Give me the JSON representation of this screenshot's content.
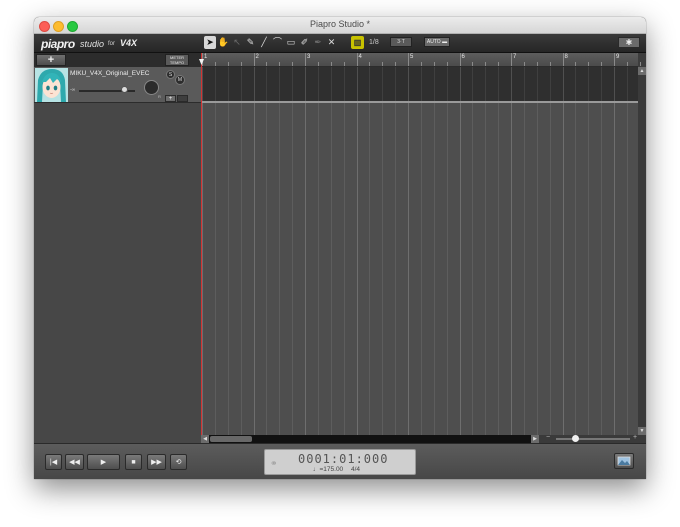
{
  "window": {
    "title": "Piapro Studio *"
  },
  "brand": {
    "logo": "piapro",
    "logo_studio": "studio",
    "logo_for": "for",
    "logo_v4x": "V4X"
  },
  "toolbar": {
    "tools": [
      {
        "name": "select-tool-icon",
        "glyph": "➤",
        "active": true
      },
      {
        "name": "hand-tool-icon",
        "glyph": "✋"
      },
      {
        "name": "arrow-tool-icon",
        "glyph": "↖",
        "dim": true
      },
      {
        "name": "pencil-tool-icon",
        "glyph": "✎"
      },
      {
        "name": "line-tool-icon",
        "glyph": "╱"
      },
      {
        "name": "curve-tool-icon",
        "glyph": "⌒"
      },
      {
        "name": "eraser-tool-icon",
        "glyph": "▭"
      },
      {
        "name": "brush-tool-icon",
        "glyph": "✐"
      },
      {
        "name": "pen-tool-icon",
        "glyph": "✒",
        "dim": true
      },
      {
        "name": "cut-tool-icon",
        "glyph": "✕"
      }
    ],
    "snap_label": "▥",
    "quantize": "1/8",
    "triplet": "3·T",
    "auto": "AUTO ▬"
  },
  "trackhead": {
    "add_label": "+",
    "meter_label": "METER",
    "tempo_label": "TEMPO",
    "track": {
      "name": "MIKU_V4X_Original_EVEC",
      "solo": "S",
      "mute": "M",
      "vol_label": "-∞",
      "pan_label": "R",
      "expand_label": "+"
    }
  },
  "ruler": {
    "bars": [
      "1",
      "2",
      "3",
      "4",
      "5",
      "6",
      "7",
      "8",
      "9"
    ]
  },
  "transport": {
    "time": "0001:01:000",
    "tempo": "♩=175.00",
    "meter": "4/4",
    "buttons": {
      "to_start": "|◀",
      "rewind": "◀◀",
      "play": "▶",
      "stop": "■",
      "fast_forward": "▶▶",
      "loop": "⟲"
    }
  },
  "colors": {
    "playhead": "#d23333",
    "snap": "#c8c200",
    "accent": "#c8c200"
  }
}
